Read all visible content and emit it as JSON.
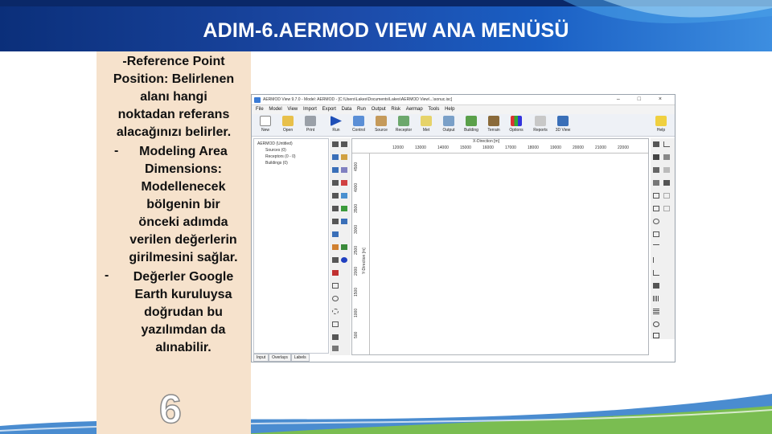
{
  "slide": {
    "title": "ADIM-6.AERMOD VIEW ANA MENÜSÜ",
    "paragraph1": [
      "-Reference Point",
      "Position: Belirlenen",
      "alanı hangi",
      "noktadan referans",
      "alacağınızı belirler."
    ],
    "bullet1_dash": "-",
    "bullet1": [
      "Modeling Area",
      "Dimensions:",
      "Modellenecek",
      "bölgenin bir",
      "önceki adımda",
      "verilen değerlerin",
      "girilmesini sağlar."
    ],
    "bullet2_dash": "-",
    "bullet2": [
      "Değerler Google",
      "Earth kuruluysa",
      "doğrudan bu",
      "yazılımdan da",
      "alınabilir."
    ],
    "page_number": "6"
  },
  "app": {
    "window_title": "AERMOD View 9.7.0 - Model: AERMOD - [C:\\Users\\Lakes\\Documents\\Lakes\\AERMOD View\\...\\sonuc.isc]",
    "window_buttons": "– □ ×",
    "menu": [
      "File",
      "Model",
      "View",
      "Import",
      "Export",
      "Data",
      "Run",
      "Output",
      "Risk",
      "Aermap",
      "Tools",
      "Help"
    ],
    "toolbar": [
      "New",
      "Open",
      "Print",
      "Run",
      "Control",
      "Source",
      "Receptor",
      "Met",
      "Output",
      "Building",
      "Terrain",
      "Options",
      "Reports",
      "3D View",
      "Help"
    ],
    "tree": {
      "root": "AERMOD (Untitled)",
      "children": [
        "Sources (0)",
        "Receptors (0 - 0)",
        "Buildings (0)"
      ]
    },
    "tabs": [
      "Input",
      "Overlays",
      "Labels"
    ],
    "plot": {
      "x_title": "X-Direction [m]",
      "x_ticks": [
        "12000",
        "13000",
        "14000",
        "15000",
        "16000",
        "17000",
        "18000",
        "19000",
        "20000",
        "21000",
        "22000"
      ],
      "y_title": "Y-Direction [m]",
      "y_ticks": [
        "4500",
        "4000",
        "3500",
        "3000",
        "2500",
        "2000",
        "1500",
        "1000",
        "500"
      ]
    }
  },
  "colors": {
    "banner_dark": "#0b2f7a",
    "banner_light": "#3d8ee0",
    "text_panel": "#f6e2cc"
  }
}
